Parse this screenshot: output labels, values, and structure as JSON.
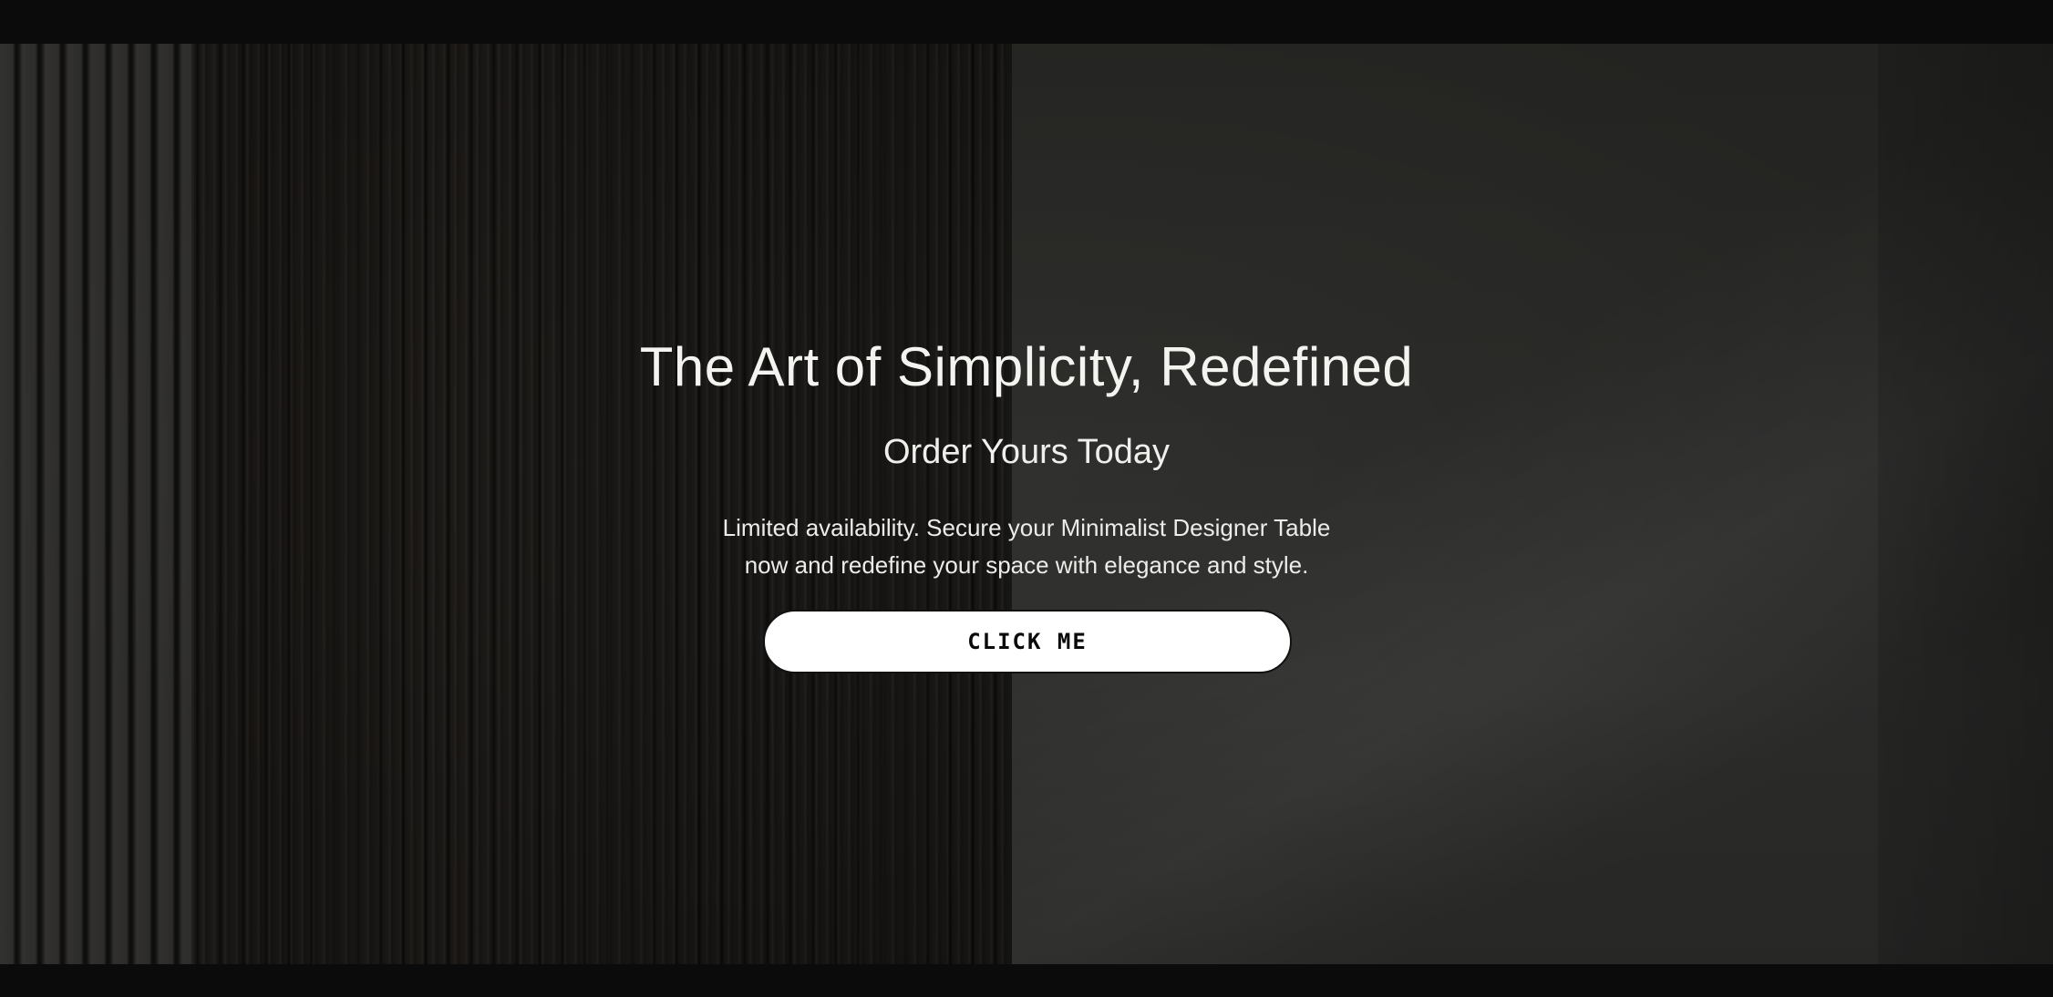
{
  "hero": {
    "headline": "The Art of Simplicity, Redefined",
    "subheadline": "Order Yours Today",
    "description_line1": "Limited availability. Secure your Minimalist Designer Table",
    "description_line2": "now and redefine your space with elegance and style.",
    "cta_label": "CLICK ME"
  },
  "colors": {
    "page_background": "#0b0b0b",
    "text": "#f1f1ee",
    "button_background": "#ffffff",
    "button_text": "#0a0a0a"
  }
}
